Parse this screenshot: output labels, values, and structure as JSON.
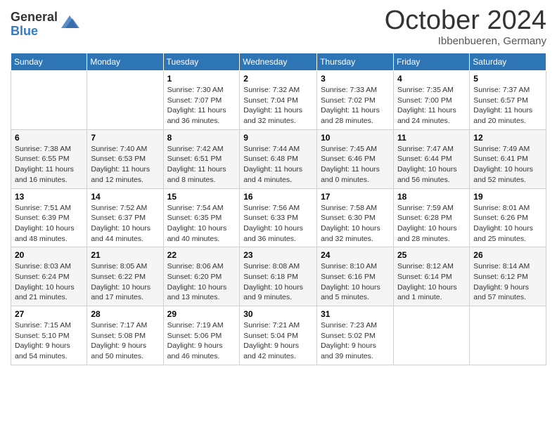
{
  "logo": {
    "general": "General",
    "blue": "Blue"
  },
  "title": "October 2024",
  "location": "Ibbenbueren, Germany",
  "days_of_week": [
    "Sunday",
    "Monday",
    "Tuesday",
    "Wednesday",
    "Thursday",
    "Friday",
    "Saturday"
  ],
  "weeks": [
    [
      {
        "day": "",
        "detail": ""
      },
      {
        "day": "",
        "detail": ""
      },
      {
        "day": "1",
        "detail": "Sunrise: 7:30 AM\nSunset: 7:07 PM\nDaylight: 11 hours\nand 36 minutes."
      },
      {
        "day": "2",
        "detail": "Sunrise: 7:32 AM\nSunset: 7:04 PM\nDaylight: 11 hours\nand 32 minutes."
      },
      {
        "day": "3",
        "detail": "Sunrise: 7:33 AM\nSunset: 7:02 PM\nDaylight: 11 hours\nand 28 minutes."
      },
      {
        "day": "4",
        "detail": "Sunrise: 7:35 AM\nSunset: 7:00 PM\nDaylight: 11 hours\nand 24 minutes."
      },
      {
        "day": "5",
        "detail": "Sunrise: 7:37 AM\nSunset: 6:57 PM\nDaylight: 11 hours\nand 20 minutes."
      }
    ],
    [
      {
        "day": "6",
        "detail": "Sunrise: 7:38 AM\nSunset: 6:55 PM\nDaylight: 11 hours\nand 16 minutes."
      },
      {
        "day": "7",
        "detail": "Sunrise: 7:40 AM\nSunset: 6:53 PM\nDaylight: 11 hours\nand 12 minutes."
      },
      {
        "day": "8",
        "detail": "Sunrise: 7:42 AM\nSunset: 6:51 PM\nDaylight: 11 hours\nand 8 minutes."
      },
      {
        "day": "9",
        "detail": "Sunrise: 7:44 AM\nSunset: 6:48 PM\nDaylight: 11 hours\nand 4 minutes."
      },
      {
        "day": "10",
        "detail": "Sunrise: 7:45 AM\nSunset: 6:46 PM\nDaylight: 11 hours\nand 0 minutes."
      },
      {
        "day": "11",
        "detail": "Sunrise: 7:47 AM\nSunset: 6:44 PM\nDaylight: 10 hours\nand 56 minutes."
      },
      {
        "day": "12",
        "detail": "Sunrise: 7:49 AM\nSunset: 6:41 PM\nDaylight: 10 hours\nand 52 minutes."
      }
    ],
    [
      {
        "day": "13",
        "detail": "Sunrise: 7:51 AM\nSunset: 6:39 PM\nDaylight: 10 hours\nand 48 minutes."
      },
      {
        "day": "14",
        "detail": "Sunrise: 7:52 AM\nSunset: 6:37 PM\nDaylight: 10 hours\nand 44 minutes."
      },
      {
        "day": "15",
        "detail": "Sunrise: 7:54 AM\nSunset: 6:35 PM\nDaylight: 10 hours\nand 40 minutes."
      },
      {
        "day": "16",
        "detail": "Sunrise: 7:56 AM\nSunset: 6:33 PM\nDaylight: 10 hours\nand 36 minutes."
      },
      {
        "day": "17",
        "detail": "Sunrise: 7:58 AM\nSunset: 6:30 PM\nDaylight: 10 hours\nand 32 minutes."
      },
      {
        "day": "18",
        "detail": "Sunrise: 7:59 AM\nSunset: 6:28 PM\nDaylight: 10 hours\nand 28 minutes."
      },
      {
        "day": "19",
        "detail": "Sunrise: 8:01 AM\nSunset: 6:26 PM\nDaylight: 10 hours\nand 25 minutes."
      }
    ],
    [
      {
        "day": "20",
        "detail": "Sunrise: 8:03 AM\nSunset: 6:24 PM\nDaylight: 10 hours\nand 21 minutes."
      },
      {
        "day": "21",
        "detail": "Sunrise: 8:05 AM\nSunset: 6:22 PM\nDaylight: 10 hours\nand 17 minutes."
      },
      {
        "day": "22",
        "detail": "Sunrise: 8:06 AM\nSunset: 6:20 PM\nDaylight: 10 hours\nand 13 minutes."
      },
      {
        "day": "23",
        "detail": "Sunrise: 8:08 AM\nSunset: 6:18 PM\nDaylight: 10 hours\nand 9 minutes."
      },
      {
        "day": "24",
        "detail": "Sunrise: 8:10 AM\nSunset: 6:16 PM\nDaylight: 10 hours\nand 5 minutes."
      },
      {
        "day": "25",
        "detail": "Sunrise: 8:12 AM\nSunset: 6:14 PM\nDaylight: 10 hours\nand 1 minute."
      },
      {
        "day": "26",
        "detail": "Sunrise: 8:14 AM\nSunset: 6:12 PM\nDaylight: 9 hours\nand 57 minutes."
      }
    ],
    [
      {
        "day": "27",
        "detail": "Sunrise: 7:15 AM\nSunset: 5:10 PM\nDaylight: 9 hours\nand 54 minutes."
      },
      {
        "day": "28",
        "detail": "Sunrise: 7:17 AM\nSunset: 5:08 PM\nDaylight: 9 hours\nand 50 minutes."
      },
      {
        "day": "29",
        "detail": "Sunrise: 7:19 AM\nSunset: 5:06 PM\nDaylight: 9 hours\nand 46 minutes."
      },
      {
        "day": "30",
        "detail": "Sunrise: 7:21 AM\nSunset: 5:04 PM\nDaylight: 9 hours\nand 42 minutes."
      },
      {
        "day": "31",
        "detail": "Sunrise: 7:23 AM\nSunset: 5:02 PM\nDaylight: 9 hours\nand 39 minutes."
      },
      {
        "day": "",
        "detail": ""
      },
      {
        "day": "",
        "detail": ""
      }
    ]
  ]
}
